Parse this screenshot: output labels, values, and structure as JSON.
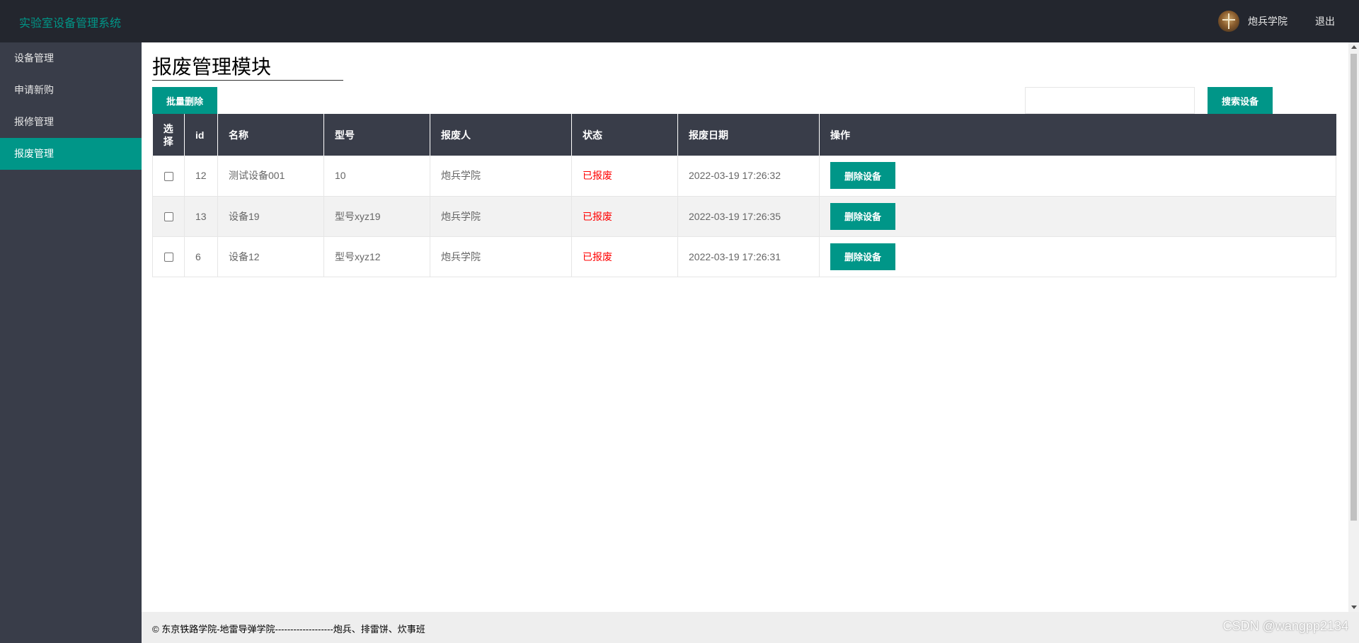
{
  "header": {
    "app_title": "实验室设备管理系统",
    "user_name": "炮兵学院",
    "logout_label": "退出",
    "avatar_icon": "avatar-image"
  },
  "sidebar": {
    "items": [
      {
        "label": "设备管理",
        "active": false
      },
      {
        "label": "申请新购",
        "active": false
      },
      {
        "label": "报修管理",
        "active": false
      },
      {
        "label": "报废管理",
        "active": true
      }
    ]
  },
  "main": {
    "page_title": "报废管理模块",
    "batch_delete_label": "批量删除",
    "search_placeholder": "",
    "search_label": "搜索设备",
    "table": {
      "headers": [
        "选择",
        "id",
        "名称",
        "型号",
        "报废人",
        "状态",
        "报废日期",
        "操作"
      ],
      "rows": [
        {
          "id": "12",
          "name": "测试设备001",
          "model": "10",
          "person": "炮兵学院",
          "status": "已报废",
          "date": "2022-03-19 17:26:32",
          "action": "删除设备"
        },
        {
          "id": "13",
          "name": "设备19",
          "model": "型号xyz19",
          "person": "炮兵学院",
          "status": "已报废",
          "date": "2022-03-19 17:26:35",
          "action": "删除设备"
        },
        {
          "id": "6",
          "name": "设备12",
          "model": "型号xyz12",
          "person": "炮兵学院",
          "status": "已报废",
          "date": "2022-03-19 17:26:31",
          "action": "删除设备"
        }
      ]
    }
  },
  "footer": {
    "copyright": "© 东京铁路学院-地雷导弹学院-------------------炮兵、排雷饼、炊事班",
    "watermark": "CSDN @wangpp2134"
  },
  "colors": {
    "accent": "#009688",
    "header_bg": "#23262e",
    "sidebar_bg": "#393d49",
    "status_red": "#ff0000"
  }
}
